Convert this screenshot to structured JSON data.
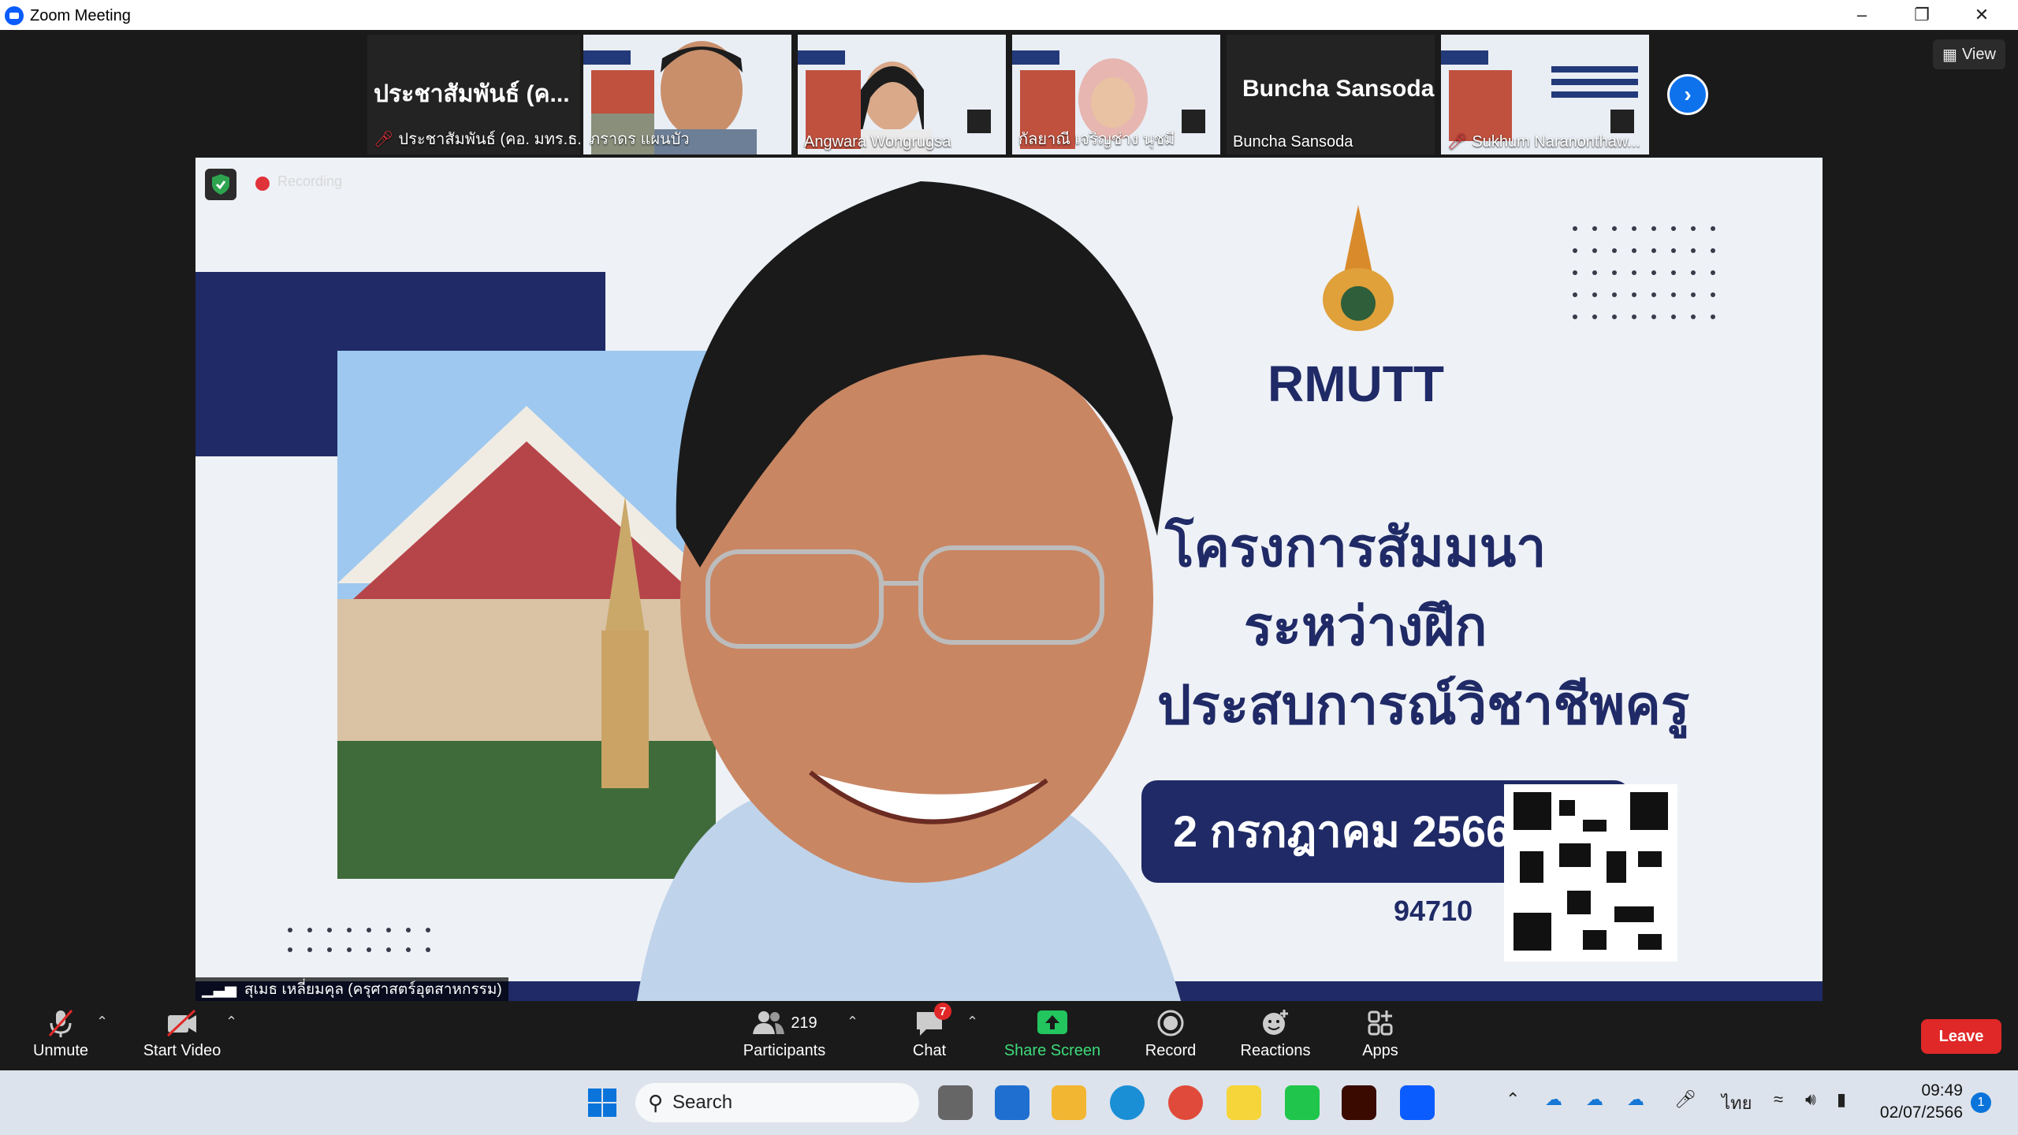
{
  "window": {
    "title": "Zoom Meeting"
  },
  "gallery": {
    "tiles": [
      {
        "display": "ประชาสัมพันธ์ (ค...",
        "name": "ประชาสัมพันธ์ (คอ. มทร.ธ...",
        "muted": true
      },
      {
        "name": "ภราดร แผนบัว",
        "muted": false
      },
      {
        "name": "Angwara Wongrugsa",
        "muted": false
      },
      {
        "name": "กัลยาณี เจริญช่าง นุชมี",
        "muted": false
      },
      {
        "display": "Buncha Sansoda",
        "name": "Buncha Sansoda",
        "muted": false
      },
      {
        "name": "Sukhum Naranonthaw...",
        "muted": true
      }
    ],
    "view_label": "View"
  },
  "main_video": {
    "recording_label": "Recording",
    "speaker_name": "สุเมธ เหลี่ยมคุล (ครุศาสตร์อุตสาหกรรม)",
    "slide": {
      "logo_text": "RMUTT",
      "line1": "โครงการสัมมนา",
      "line2": "ระหว่างฝึก",
      "line3": "ประสบการณ์วิชาชีพครู",
      "date": "2 กรกฎาคม 2566",
      "meeting_id": "94710"
    }
  },
  "toolbar": {
    "unmute": "Unmute",
    "start_video": "Start Video",
    "participants": "Participants",
    "participants_count": "219",
    "chat": "Chat",
    "chat_badge": "7",
    "share_screen": "Share Screen",
    "record": "Record",
    "reactions": "Reactions",
    "apps": "Apps",
    "leave": "Leave"
  },
  "taskbar": {
    "search_placeholder": "Search",
    "language": "ไทย",
    "time": "09:49",
    "date": "02/07/2566",
    "notification_count": "1"
  },
  "colors": {
    "accent": "#0e72ed",
    "leave": "#e02828",
    "share_green": "#22c55e"
  }
}
